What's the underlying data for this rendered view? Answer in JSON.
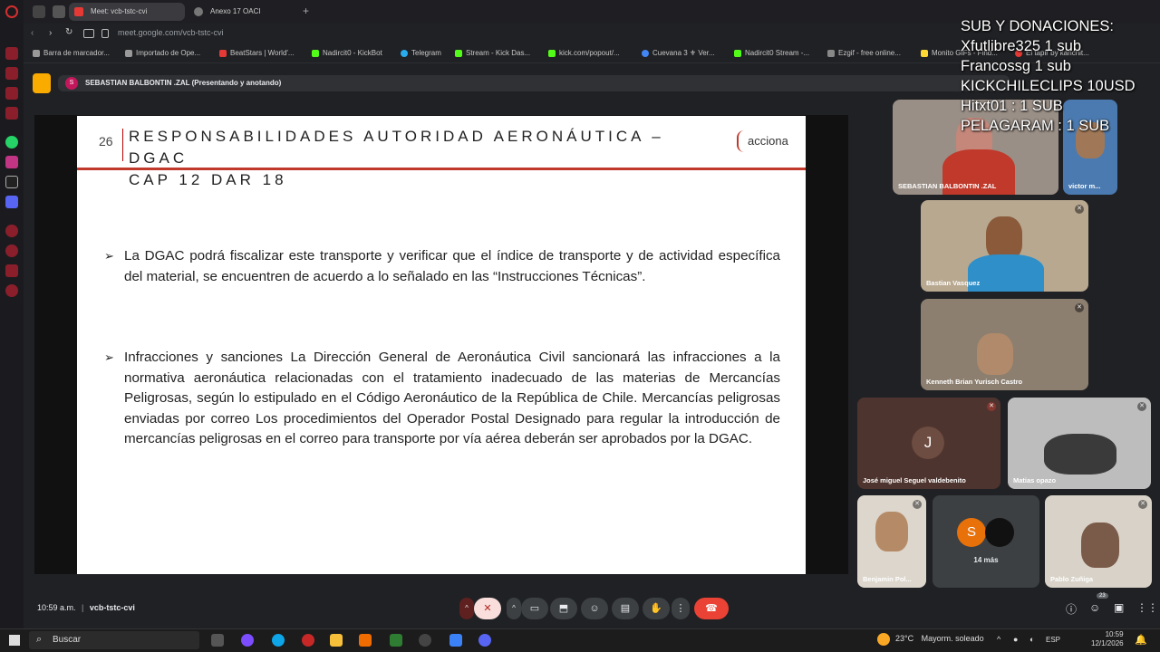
{
  "browser": {
    "tabs": [
      {
        "label": "Meet: vcb-tstc-cvi",
        "active": true
      },
      {
        "label": "Anexo 17 OACI",
        "active": false
      }
    ],
    "url": "meet.google.com/vcb-tstc-cvi",
    "bookmarks": [
      "Barra de marcador...",
      "Importado de Ope...",
      "BeatStars | World'...",
      "Nadircit0 - KickBot",
      "Telegram",
      "Stream - Kick Das...",
      "kick.com/popout/...",
      "Cuevana 3 ⚜ Ver...",
      "Nadircit0 Stream -...",
      "Ezgif - free online...",
      "Monito GIFs - Find...",
      "El tapir by kanchit..."
    ]
  },
  "meet": {
    "presenter_chip": "SEBASTIAN BALBONTIN .ZAL (Presentando y anotando)",
    "presenter_initial": "S",
    "time": "10:59 a.m.",
    "separator": "|",
    "meeting_code": "vcb-tstc-cvi",
    "participant_count_badge": "23",
    "participants": [
      {
        "name": "SEBASTIAN BALBONTIN .ZAL"
      },
      {
        "name": "victor m..."
      },
      {
        "name": "Bastian Vasquez"
      },
      {
        "name": "Kenneth Brian Yurisch Castro"
      },
      {
        "name": "José miguel Seguel valdebenito",
        "initial": "J"
      },
      {
        "name": "Matias opazo"
      },
      {
        "name": "Benjamin Pol..."
      },
      {
        "name": "14 más",
        "initial": "S"
      },
      {
        "name": "Pablo Zuñiga"
      }
    ]
  },
  "slide": {
    "number": "26",
    "title_line1": "RESPONSABILIDADES AUTORIDAD AERONÁUTICA –DGAC",
    "title_line2": "CAP 12 DAR 18",
    "logo_text": "acciona",
    "arrow": "➢",
    "bullets": [
      "La DGAC podrá fiscalizar este transporte y verificar que el índice de transporte y de actividad específica del material, se encuentren de acuerdo a lo señalado en las “Instrucciones Técnicas”.",
      "Infracciones y sanciones La Dirección General de Aeronáutica Civil sancionará las infracciones a la normativa aeronáutica relacionadas con el tratamiento inadecuado de las materias de Mercancías Peligrosas, según lo estipulado en el Código Aeronáutico de la República de Chile. Mercancías peligrosas enviadas por correo Los procedimientos del Operador Postal Designado para regular la introducción de mercancías peligrosas en el correo para transporte por vía aérea deberán ser aprobados por la DGAC."
    ]
  },
  "overlay": {
    "lines": [
      "SUB Y DONACIONES:",
      "Xfutlibre325 1 sub",
      "Francossg 1 sub",
      "KICKCHILECLIPS 10USD",
      "Hitxt01 : 1 SUB",
      "PELAGARAM : 1 SUB"
    ]
  },
  "taskbar": {
    "search_placeholder": "Buscar",
    "weather_temp": "23°C",
    "weather_desc": "Mayorm. soleado",
    "language": "ESP",
    "time": "10:59",
    "date": "12/1/2026"
  },
  "colors": {
    "meet_bg": "#202124",
    "slide_red": "#c0392b",
    "end_call": "#ea4335",
    "accent_yellow": "#f9ab00"
  }
}
